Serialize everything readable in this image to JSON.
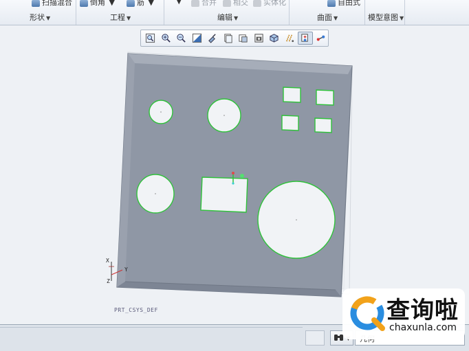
{
  "ribbon": {
    "cut_items": [
      {
        "label": "扫描混合",
        "icon": "sweep-blend-icon",
        "dim": false
      },
      {
        "label": "倒角",
        "icon": "chamfer-icon",
        "dim": false
      },
      {
        "label": "筋",
        "icon": "rib-icon",
        "dim": false
      },
      {
        "label": "合并",
        "icon": "merge-icon",
        "dim": true
      },
      {
        "label": "相交",
        "icon": "intersect-icon",
        "dim": true
      },
      {
        "label": "实体化",
        "icon": "solidify-icon",
        "dim": true
      },
      {
        "label": "自由式",
        "icon": "freestyle-icon",
        "dim": false
      }
    ],
    "groups": [
      {
        "label": "形状",
        "caret": "▼"
      },
      {
        "label": "工程",
        "caret": "▼"
      },
      {
        "label": "编辑",
        "caret": "▼"
      },
      {
        "label": "曲面",
        "caret": "▼"
      },
      {
        "label": "模型意图",
        "caret": "▼"
      }
    ]
  },
  "toolbar": {
    "buttons": [
      {
        "name": "refit-icon",
        "active": false
      },
      {
        "name": "zoom-in-icon",
        "active": false
      },
      {
        "name": "zoom-out-icon",
        "active": false
      },
      {
        "name": "repaint-icon",
        "active": false
      },
      {
        "name": "reorient-icon",
        "active": false
      },
      {
        "name": "saved-views-icon",
        "active": false
      },
      {
        "name": "display-style-icon",
        "active": false
      },
      {
        "name": "view-manager-icon",
        "active": false
      },
      {
        "name": "perspective-icon",
        "active": false
      },
      {
        "name": "datum-display-icon",
        "active": false
      },
      {
        "name": "spin-center-icon",
        "active": true
      },
      {
        "name": "annotation-display-icon",
        "active": false
      }
    ]
  },
  "viewport": {
    "csys_label": "PRT_CSYS_DEF",
    "axis_x": "X",
    "axis_y": "Y",
    "axis_z": "Z",
    "colors": {
      "plate": "#8f97a5",
      "plate_edge": "#727b89",
      "hole_edge": "#2fc23a",
      "hole_fill": "#f1f3f6"
    }
  },
  "statusbar": {
    "find_icon": "binoculars-icon",
    "filter_value": "几何"
  },
  "watermark": {
    "logo": "magnifier-logo-icon",
    "text_cn": "查询啦",
    "text_en": "chaxunla.com"
  }
}
